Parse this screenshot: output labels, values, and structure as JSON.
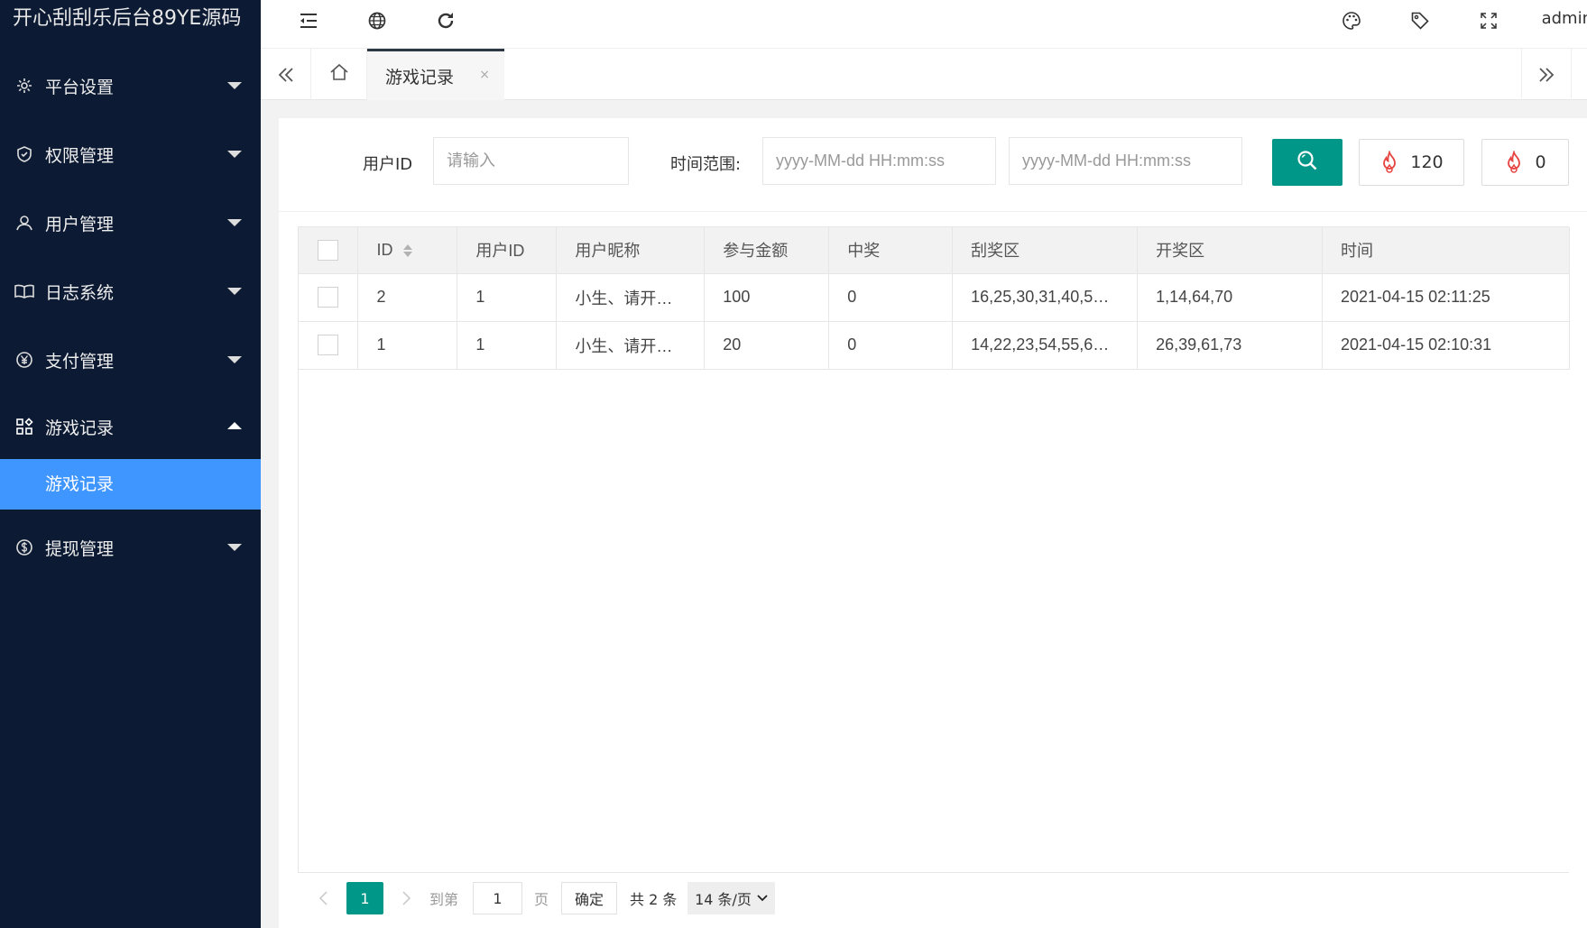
{
  "app": {
    "title": "开心刮刮乐后台89YE源码"
  },
  "sidebar": {
    "items": [
      {
        "label": "平台设置",
        "icon": "gear-icon"
      },
      {
        "label": "权限管理",
        "icon": "shield-icon"
      },
      {
        "label": "用户管理",
        "icon": "user-icon"
      },
      {
        "label": "日志系统",
        "icon": "book-icon"
      },
      {
        "label": "支付管理",
        "icon": "yen-icon"
      },
      {
        "label": "游戏记录",
        "icon": "apps-icon",
        "expanded": true
      },
      {
        "label": "提现管理",
        "icon": "dollar-icon"
      }
    ],
    "submenu": {
      "label": "游戏记录"
    }
  },
  "topbar": {
    "user": "admin"
  },
  "tabs": {
    "active_label": "游戏记录",
    "close": "×"
  },
  "filter": {
    "userid_label": "用户ID",
    "userid_placeholder": "请输入",
    "time_label": "时间范围:",
    "start_placeholder": "yyyy-MM-dd HH:mm:ss",
    "end_placeholder": "yyyy-MM-dd HH:mm:ss",
    "count1": "120",
    "count2": "0"
  },
  "table": {
    "headers": [
      "ID",
      "用户ID",
      "用户昵称",
      "参与金额",
      "中奖",
      "刮奖区",
      "开奖区",
      "时间"
    ],
    "rows": [
      [
        "2",
        "1",
        "小生、请开…",
        "100",
        "0",
        "16,25,30,31,40,5…",
        "1,14,64,70",
        "2021-04-15 02:11:25"
      ],
      [
        "1",
        "1",
        "小生、请开…",
        "20",
        "0",
        "14,22,23,54,55,6…",
        "26,39,61,73",
        "2021-04-15 02:10:31"
      ]
    ]
  },
  "pager": {
    "current": "1",
    "goto_label": "到第",
    "goto_value": "1",
    "page_label": "页",
    "confirm": "确定",
    "total": "共 2 条",
    "page_size": "14 条/页"
  },
  "colors": {
    "sidebar_bg": "#0c1a33",
    "active_menu": "#4096ff",
    "primary": "#009688",
    "fire": "#e64340"
  }
}
